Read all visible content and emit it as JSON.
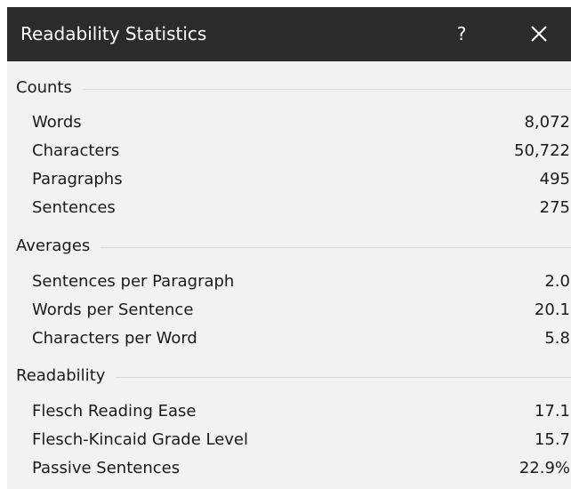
{
  "window": {
    "title": "Readability Statistics",
    "help_label": "?",
    "close_icon": "close-icon",
    "titlebar_color": "#2b2b2b",
    "background_color": "#f2f2f2"
  },
  "groups": [
    {
      "label": "Counts",
      "rows": [
        {
          "name": "Words",
          "value": "8,072"
        },
        {
          "name": "Characters",
          "value": "50,722"
        },
        {
          "name": "Paragraphs",
          "value": "495"
        },
        {
          "name": "Sentences",
          "value": "275"
        }
      ]
    },
    {
      "label": "Averages",
      "rows": [
        {
          "name": "Sentences per Paragraph",
          "value": "2.0"
        },
        {
          "name": "Words per Sentence",
          "value": "20.1"
        },
        {
          "name": "Characters per Word",
          "value": "5.8"
        }
      ]
    },
    {
      "label": "Readability",
      "rows": [
        {
          "name": "Flesch Reading Ease",
          "value": "17.1"
        },
        {
          "name": "Flesch-Kincaid Grade Level",
          "value": "15.7"
        },
        {
          "name": "Passive Sentences",
          "value": "22.9%"
        }
      ]
    }
  ]
}
